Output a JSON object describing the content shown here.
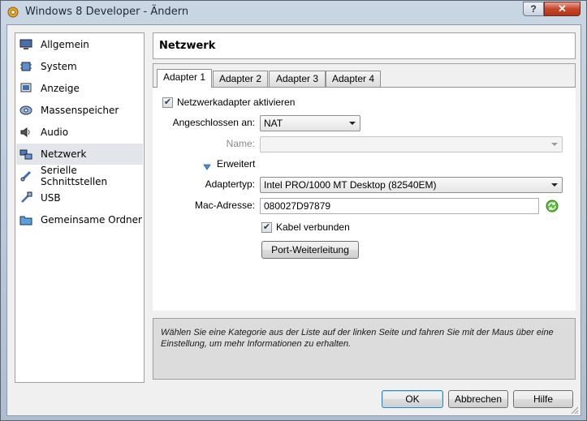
{
  "window": {
    "title": "Windows 8 Developer - Ändern",
    "help_label": "?",
    "close_label": "✕"
  },
  "sidebar": {
    "items": [
      {
        "label": "Allgemein",
        "icon": "monitor-icon"
      },
      {
        "label": "System",
        "icon": "chip-icon"
      },
      {
        "label": "Anzeige",
        "icon": "display-icon"
      },
      {
        "label": "Massenspeicher",
        "icon": "disk-icon"
      },
      {
        "label": "Audio",
        "icon": "speaker-icon"
      },
      {
        "label": "Netzwerk",
        "icon": "network-icon",
        "selected": true
      },
      {
        "label": "Serielle Schnittstellen",
        "icon": "serial-port-icon"
      },
      {
        "label": "USB",
        "icon": "usb-icon"
      },
      {
        "label": "Gemeinsame Ordner",
        "icon": "folder-icon"
      }
    ]
  },
  "page": {
    "title": "Netzwerk"
  },
  "tabs": [
    {
      "label": "Adapter 1",
      "active": true
    },
    {
      "label": "Adapter 2"
    },
    {
      "label": "Adapter 3"
    },
    {
      "label": "Adapter 4"
    }
  ],
  "adapter": {
    "enable_label": "Netzwerkadapter aktivieren",
    "enable_checked": true,
    "attached_label": "Angeschlossen an:",
    "attached_value": "NAT",
    "name_label": "Name:",
    "name_value": "",
    "advanced_label": "Erweitert",
    "type_label": "Adaptertyp:",
    "type_value": "Intel PRO/1000 MT Desktop (82540EM)",
    "mac_label": "Mac-Adresse:",
    "mac_value": "080027D97879",
    "cable_label": "Kabel verbunden",
    "cable_checked": true,
    "port_forward_label": "Port-Weiterleitung"
  },
  "info": {
    "text": "Wählen Sie eine Kategorie aus der Liste auf der linken Seite und fahren Sie mit der Maus über eine Einstellung, um mehr Informationen zu erhalten."
  },
  "footer": {
    "ok_label": "OK",
    "cancel_label": "Abbrechen",
    "help_label": "Hilfe"
  },
  "colors": {
    "accent": "#3c7fb1",
    "selected_row": "#e2e6ea",
    "close_button": "#c7452c"
  }
}
